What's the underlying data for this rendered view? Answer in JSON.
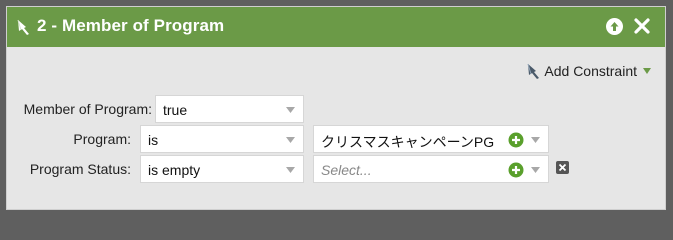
{
  "header": {
    "title": "2 - Member of Program",
    "title_icon": "filter-wand-icon",
    "up_icon": "arrow-up-circle-icon",
    "close_icon": "close-x-icon",
    "bar_color": "#6b9a47"
  },
  "toolbar": {
    "add_constraint_label": "Add Constraint",
    "add_constraint_icon": "filter-wand-icon",
    "add_constraint_dropdown_icon": "triangle-down-icon"
  },
  "rows": [
    {
      "label": "Member of Program:",
      "value": "true"
    },
    {
      "label": "Program:",
      "operator": "is",
      "value": "クリスマスキャンペーンPG",
      "add_icon": "plus-circle-icon"
    },
    {
      "label": "Program Status:",
      "operator": "is empty",
      "placeholder": "Select...",
      "add_icon": "plus-circle-icon",
      "remove_icon": "square-x-icon"
    }
  ],
  "colors": {
    "accent_green": "#6b9a47",
    "plus_green": "#5aa02c",
    "panel_bg": "#e6e6e6"
  }
}
